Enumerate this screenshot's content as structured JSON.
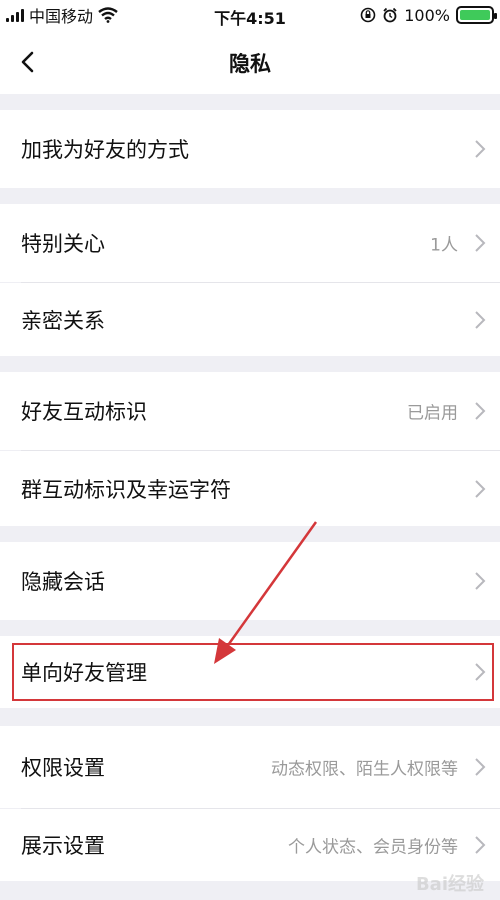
{
  "status_bar": {
    "carrier": "中国移动",
    "time": "下午4:51",
    "battery": "100%"
  },
  "nav": {
    "title": "隐私",
    "back_icon": "chevron-left-icon"
  },
  "rows": [
    {
      "label": "加我为好友的方式",
      "value": ""
    },
    {
      "label": "特别关心",
      "value": "1人"
    },
    {
      "label": "亲密关系",
      "value": ""
    },
    {
      "label": "好友互动标识",
      "value": "已启用"
    },
    {
      "label": "群互动标识及幸运字符",
      "value": ""
    },
    {
      "label": "隐藏会话",
      "value": ""
    },
    {
      "label": "单向好友管理",
      "value": ""
    },
    {
      "label": "权限设置",
      "value": "动态权限、陌生人权限等"
    },
    {
      "label": "展示设置",
      "value": "个人状态、会员身份等"
    }
  ],
  "annotation": {
    "highlight_color": "#d4373a",
    "highlighted_row": "单向好友管理"
  },
  "colors": {
    "background": "#efeff4",
    "cell": "#ffffff",
    "secondary_text": "#9a9a9a",
    "battery": "#3fca5a"
  }
}
